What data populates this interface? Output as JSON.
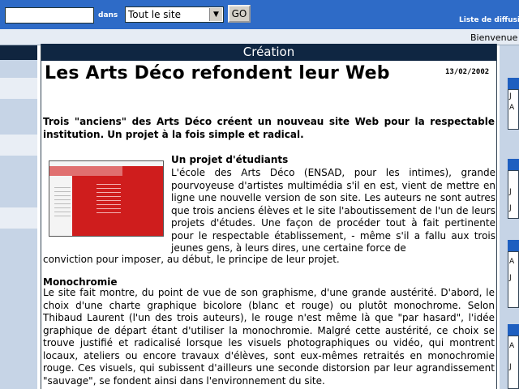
{
  "topbar": {
    "search_value": "",
    "dans_label": "dans",
    "site_select_value": "Tout le site",
    "go_label": "GO",
    "liste_label": "Liste de diffusion"
  },
  "subbar": {
    "bienvenue": "Bienvenue"
  },
  "article": {
    "section": "Création",
    "title": "Les Arts Déco refondent leur Web",
    "date": "13/02/2002",
    "intro": "Trois \"anciens\" des Arts Déco créent un nouveau site Web pour la respectable institution. Un projet à la fois simple et radical.",
    "subheading_1": "Un projet d'étudiants",
    "paragraph_1": "L'école des Arts Déco (ENSAD, pour les intimes), grande pourvoyeuse d'artistes multimédia s'il en est, vient de mettre en ligne une nouvelle version de son site. Les auteurs ne sont autres que trois anciens élèves et le site l'aboutissement de l'un de leurs projets d'études. Une façon de procéder tout à fait pertinente pour le respectable établissement, - même s'il a fallu aux trois jeunes gens, à leurs dires, une certaine force de",
    "paragraph_1_end": "conviction pour imposer, au début, le principe de leur projet.",
    "subheading_2": "Monochromie",
    "paragraph_2": "Le site fait montre, du point de vue de son graphisme, d'une grande austérité. D'abord, le choix d'une charte graphique bicolore (blanc et rouge) ou plutôt monochrome. Selon Thibaud Laurent (l'un des trois auteurs), le rouge n'est même là que \"par hasard\", l'idée graphique de départ étant d'utiliser la monochromie. Malgré cette austérité, ce choix se trouve justifié et radicalisé lorsque les visuels photographiques ou vidéo, qui montrent locaux, ateliers ou encore travaux d'élèves, sont eux-mêmes retraités en monochromie rouge. Ces visuels, qui subissent d'ailleurs une seconde distorsion par leur agrandissement \"sauvage\", se fondent ainsi dans l'environnement du site."
  },
  "right_column": {
    "letters": [
      "J",
      "A",
      "J",
      "J",
      "A",
      "J",
      "A",
      "J"
    ]
  },
  "colors": {
    "topbar": "#2e6bc7",
    "section_header": "#0f2642",
    "thumbnail_red": "#cf1d1d"
  }
}
